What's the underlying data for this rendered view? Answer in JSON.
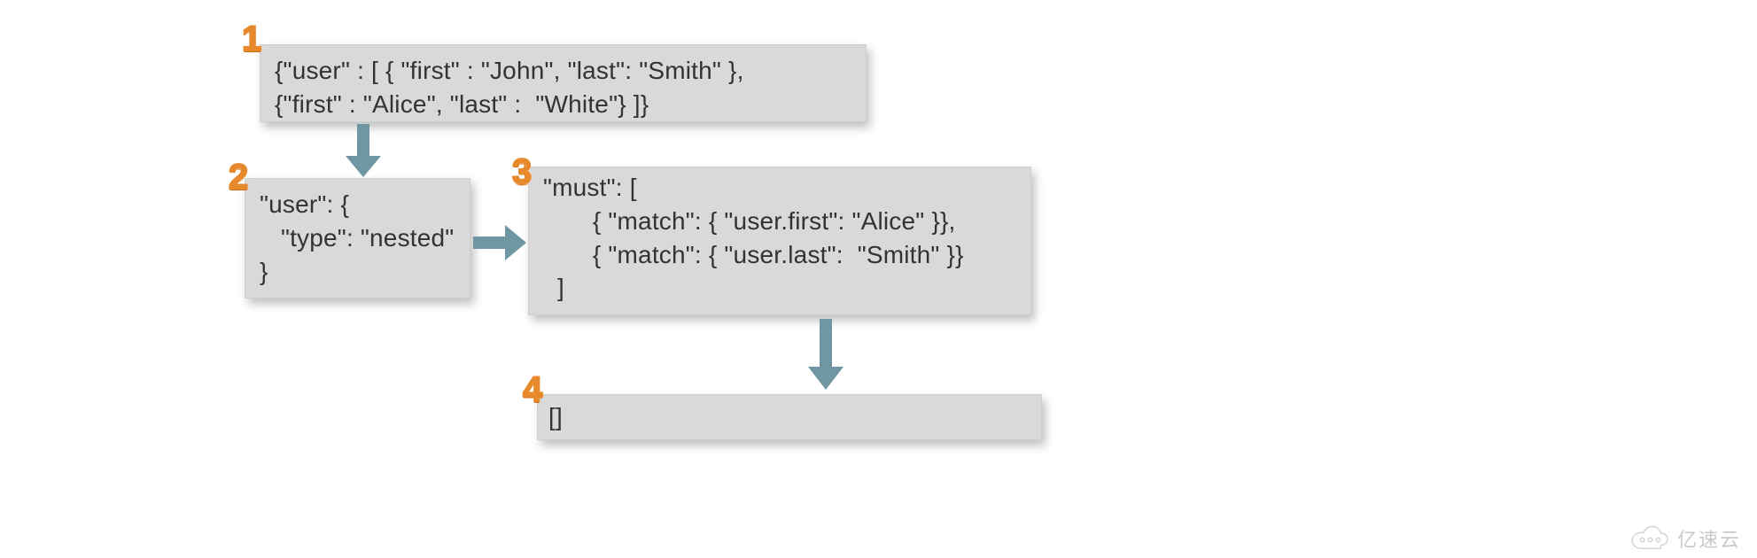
{
  "badges": {
    "b1": "1",
    "b2": "2",
    "b3": "3",
    "b4": "4"
  },
  "box1": {
    "line1": "{\"user\" : [ { \"first\" : \"John\", \"last\": \"Smith\" },",
    "line2": "{\"first\" : \"Alice\", \"last\" :  \"White\"} ]}"
  },
  "box2": {
    "line1": "\"user\": {",
    "line2": "   \"type\": \"nested\"",
    "line3": "}"
  },
  "box3": {
    "line1": "\"must\": [",
    "line2": "       { \"match\": { \"user.first\": \"Alice\" }},",
    "line3": "       { \"match\": { \"user.last\":  \"Smith\" }}",
    "line4": "  ]"
  },
  "box4": {
    "content": "[]"
  },
  "watermark": {
    "text": "亿速云"
  }
}
